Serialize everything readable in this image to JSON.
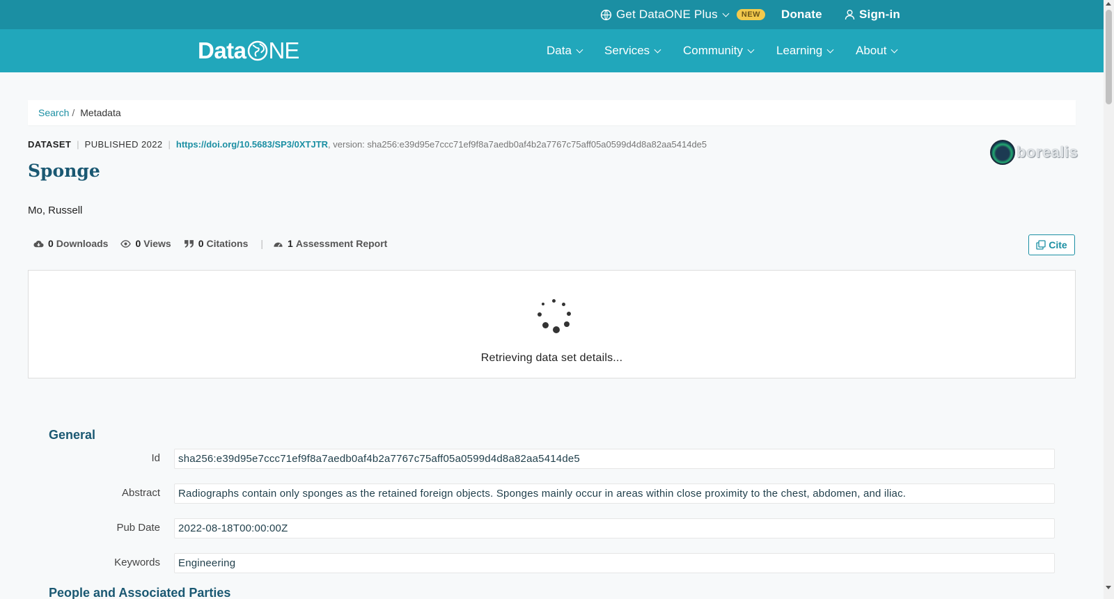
{
  "topbar": {
    "plus_label": "Get DataONE Plus",
    "plus_badge": "NEW",
    "donate_label": "Donate",
    "signin_label": "Sign-in"
  },
  "logo": {
    "data": "Data",
    "one": "NE"
  },
  "nav": {
    "items": [
      "Data",
      "Services",
      "Community",
      "Learning",
      "About"
    ]
  },
  "breadcrumb": {
    "search": "Search",
    "separator": "/",
    "current": "Metadata"
  },
  "citation": {
    "type": "DATASET",
    "published": "PUBLISHED 2022",
    "doi": "https://doi.org/10.5683/SP3/0XTJTR",
    "version": ", version: sha256:e39d95e7ccc71ef9f8a7aedb0af4b2a7767c75aff05a0599d4d8a82aa5414de5"
  },
  "repository_logo": "borealis",
  "title": "Sponge",
  "author": "Mo, Russell",
  "metrics": {
    "downloads": {
      "count": "0",
      "label": "Downloads"
    },
    "views": {
      "count": "0",
      "label": "Views"
    },
    "citations": {
      "count": "0",
      "label": "Citations"
    },
    "assessment": {
      "count": "1",
      "label": "Assessment Report"
    }
  },
  "cite_button": "Cite",
  "loading": {
    "message": "Retrieving data set details..."
  },
  "general": {
    "title": "General",
    "fields": [
      {
        "label": "Id",
        "value": "sha256:e39d95e7ccc71ef9f8a7aedb0af4b2a7767c75aff05a0599d4d8a82aa5414de5"
      },
      {
        "label": "Abstract",
        "value": "Radiographs contain only sponges as the retained foreign objects. Sponges mainly occur in areas within close proximity to the chest, abdomen, and iliac."
      },
      {
        "label": "Pub Date",
        "value": "2022-08-18T00:00:00Z"
      },
      {
        "label": "Keywords",
        "value": "Engineering"
      }
    ]
  },
  "people_section_title": "People and Associated Parties",
  "colors": {
    "topbar": "#1b8fa3",
    "navbar": "#21a7bb",
    "accent": "#1b8fa3",
    "heading": "#1a5872"
  }
}
